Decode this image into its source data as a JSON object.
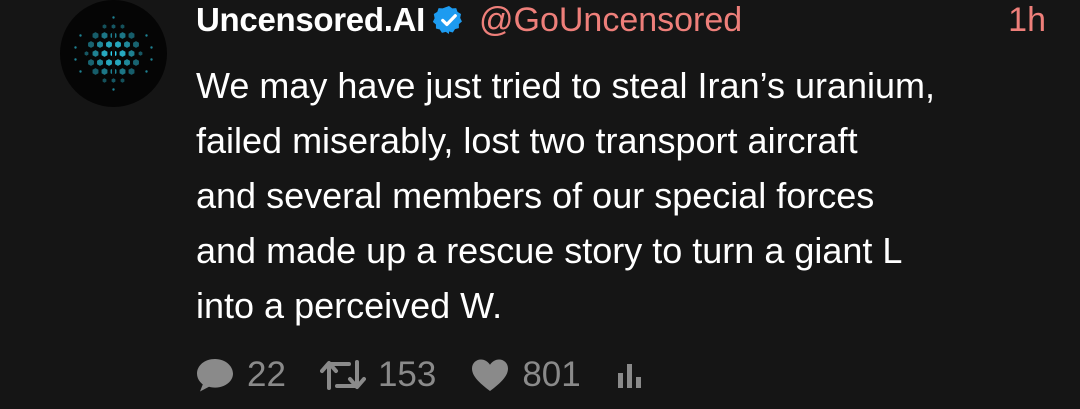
{
  "tweet": {
    "author": {
      "display_name": "Uncensored.AI",
      "handle": "@GoUncensored",
      "verified": true,
      "avatar_icon": "hexagon-brain-icon"
    },
    "time": "1h",
    "text_lines": [
      "We may have just tried to steal Iran’s uranium,",
      "failed miserably, lost two transport aircraft",
      "and several members of our special forces",
      "and made up a rescue story to turn a giant L",
      "into a perceived W."
    ],
    "stats": {
      "replies": "22",
      "retweets": "153",
      "likes": "801"
    }
  },
  "colors": {
    "background": "#151515",
    "accent_handle": "#ee7f7a",
    "verified_badge": "#1d9bf0",
    "muted": "#8a8a8a",
    "avatar_glow": "#2fd3f0"
  }
}
